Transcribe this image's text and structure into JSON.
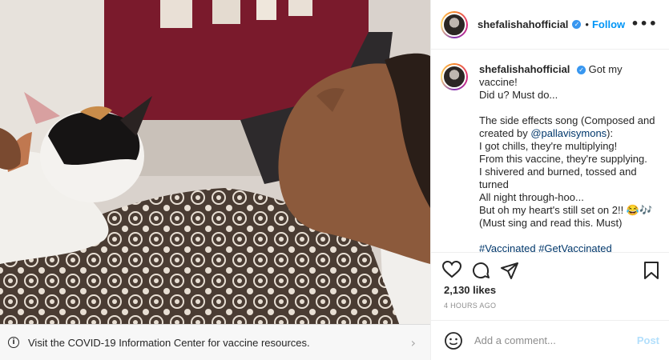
{
  "post": {
    "username": "shefalishahofficial",
    "verified_mark": "✓",
    "follow_label": "Follow",
    "more_label": "•••",
    "caption_lines": [
      "Got my vaccine!",
      "Did u? Must do..."
    ],
    "caption_body_1": "The side effects song (Composed and",
    "caption_body_2": "created by ",
    "mention": "@pallavisymons",
    "mention_suffix": "):",
    "lyrics": [
      "I got chills, they're multiplying!",
      "From this vaccine, they're supplying.",
      "I shivered and burned, tossed and",
      "turned",
      "All night through-hoo...",
      "But oh my heart's still set on 2!! 😂🎶",
      "(Must sing and read this. Must)"
    ],
    "hashtags": "#Vaccinated #GetVaccinated",
    "likes": "2,130 likes",
    "time": "4 HOURS AGO",
    "comment_placeholder": "Add a comment...",
    "post_label": "Post"
  },
  "covid": {
    "text": "Visit the COVID-19 Information Center for vaccine resources.",
    "info_icon": "i",
    "chevron": "›"
  },
  "colors": {
    "accent": "#0095f6",
    "verified": "#3897f0",
    "link": "#00376b",
    "muted": "#8e8e8e"
  }
}
